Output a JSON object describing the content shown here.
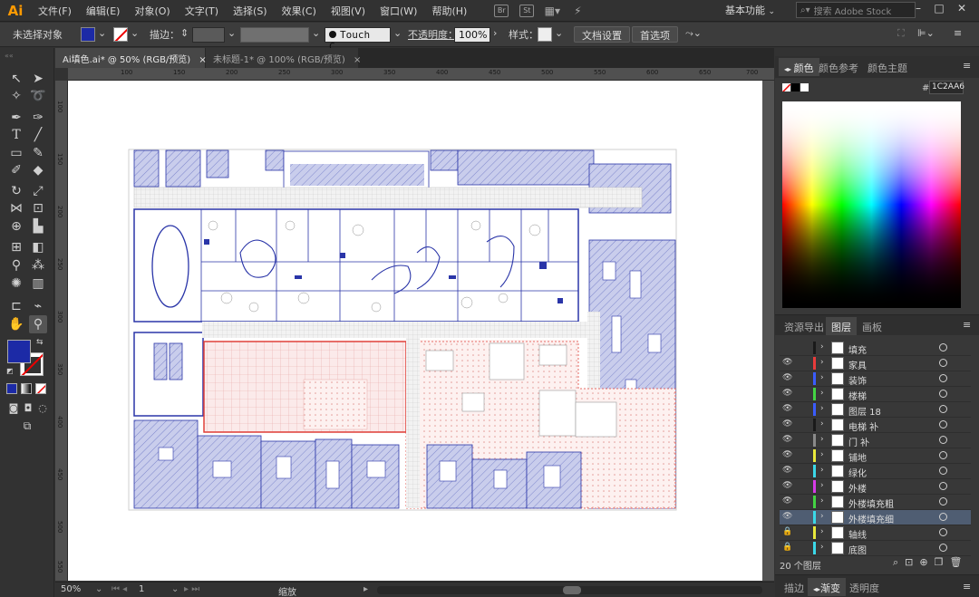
{
  "app": {
    "logo": "Ai"
  },
  "menu": [
    "文件(F)",
    "编辑(E)",
    "对象(O)",
    "文字(T)",
    "选择(S)",
    "效果(C)",
    "视图(V)",
    "窗口(W)",
    "帮助(H)"
  ],
  "menu_icons": [
    "Br",
    "St"
  ],
  "workspace": "基本功能",
  "stock_search_placeholder": "搜索 Adobe Stock",
  "control": {
    "no_selection": "未选择对象",
    "stroke_label": "描边：",
    "brush": "Touch C...",
    "opacity_label": "不透明度：",
    "opacity_value": "100%",
    "style_label": "样式：",
    "doc_setup": "文档设置",
    "prefs": "首选项"
  },
  "tabs": [
    {
      "label": "Ai填色.ai* @ 50% (RGB/预览)",
      "close": "×"
    },
    {
      "label": "未标题-1* @ 100% (RGB/预览)",
      "close": "×"
    }
  ],
  "ruler_top": [
    "100",
    "150",
    "200",
    "250",
    "300",
    "350",
    "400",
    "450",
    "500",
    "550",
    "600",
    "650",
    "700",
    "750"
  ],
  "ruler_left": [
    "100",
    "150",
    "200",
    "250",
    "300",
    "350",
    "400",
    "450",
    "500",
    "550"
  ],
  "status": {
    "zoom": "50%",
    "page": "1",
    "tool": "缩放"
  },
  "color_panel": {
    "tabs": [
      "颜色",
      "颜色参考",
      "颜色主题"
    ],
    "hex_label": "#",
    "hex": "1C2AA6"
  },
  "layers_panel": {
    "tabs": [
      "资源导出",
      "图层",
      "画板"
    ],
    "layers": [
      {
        "name": "填充",
        "color": "#1a1a1a",
        "eye": ""
      },
      {
        "name": "家具",
        "color": "#e83b3b",
        "eye": "👁"
      },
      {
        "name": "装饰",
        "color": "#3a5cff",
        "eye": "👁"
      },
      {
        "name": "楼梯",
        "color": "#44d444",
        "eye": "👁"
      },
      {
        "name": "图层 18",
        "color": "#3a5cff",
        "eye": "👁"
      },
      {
        "name": "电梯 补",
        "color": "#1a1a1a",
        "eye": "👁"
      },
      {
        "name": "门 补",
        "color": "#8a8a8a",
        "eye": "👁"
      },
      {
        "name": "铺地",
        "color": "#e8e83b",
        "eye": "👁"
      },
      {
        "name": "绿化",
        "color": "#3bd8e8",
        "eye": "👁"
      },
      {
        "name": "外楼",
        "color": "#d83be8",
        "eye": "👁"
      },
      {
        "name": "外楼填充粗",
        "color": "#44d444",
        "eye": "👁"
      },
      {
        "name": "外楼填充细",
        "color": "#3bd8e8",
        "eye": "👁"
      },
      {
        "name": "轴线",
        "color": "#e8e83b",
        "eye": "🔒"
      },
      {
        "name": "底图",
        "color": "#3bd8e8",
        "eye": "🔒"
      }
    ],
    "count": "20 个图层"
  },
  "bottom_tabs": [
    "描边",
    "渐变",
    "透明度"
  ],
  "colors": {
    "fill": "#1c2aa6",
    "plan_blue": "#2a35a8",
    "plan_fill": "#c9cdec",
    "plan_red": "#e0413a"
  }
}
